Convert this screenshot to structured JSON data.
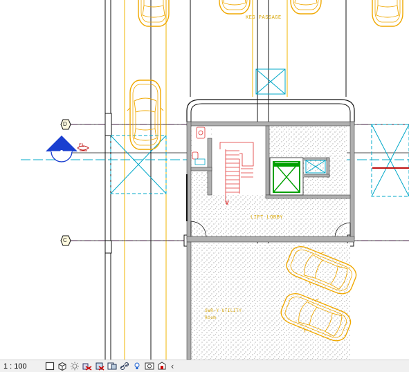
{
  "view": {
    "labels": {
      "top_label": "KEG PASSAGE",
      "lift_lobby": "LIFT LOBBY",
      "basement_text_1": "SWR-Y UTILITY",
      "basement_text_2": "Room"
    },
    "grid_bubbles": {
      "d": "D",
      "c": "C"
    },
    "elevation_tag": "E1"
  },
  "status_bar": {
    "scale": "1 : 100",
    "controls": [
      {
        "name": "detail-level",
        "icon": "square-icon"
      },
      {
        "name": "visual-style",
        "icon": "cube-icon"
      },
      {
        "name": "sun-path",
        "icon": "sun-icon"
      },
      {
        "name": "shadows",
        "icon": "shadow-icon"
      },
      {
        "name": "crop-view",
        "icon": "crop-icon"
      },
      {
        "name": "show-crop-region",
        "icon": "crop-region-icon"
      },
      {
        "name": "unlock-3d-view",
        "icon": "link-icon"
      },
      {
        "name": "temporary-hide",
        "icon": "bulb-icon"
      },
      {
        "name": "reveal-hidden",
        "icon": "reveal-icon"
      },
      {
        "name": "analytical-model",
        "icon": "model-icon"
      }
    ],
    "collapse_glyph": "‹"
  }
}
